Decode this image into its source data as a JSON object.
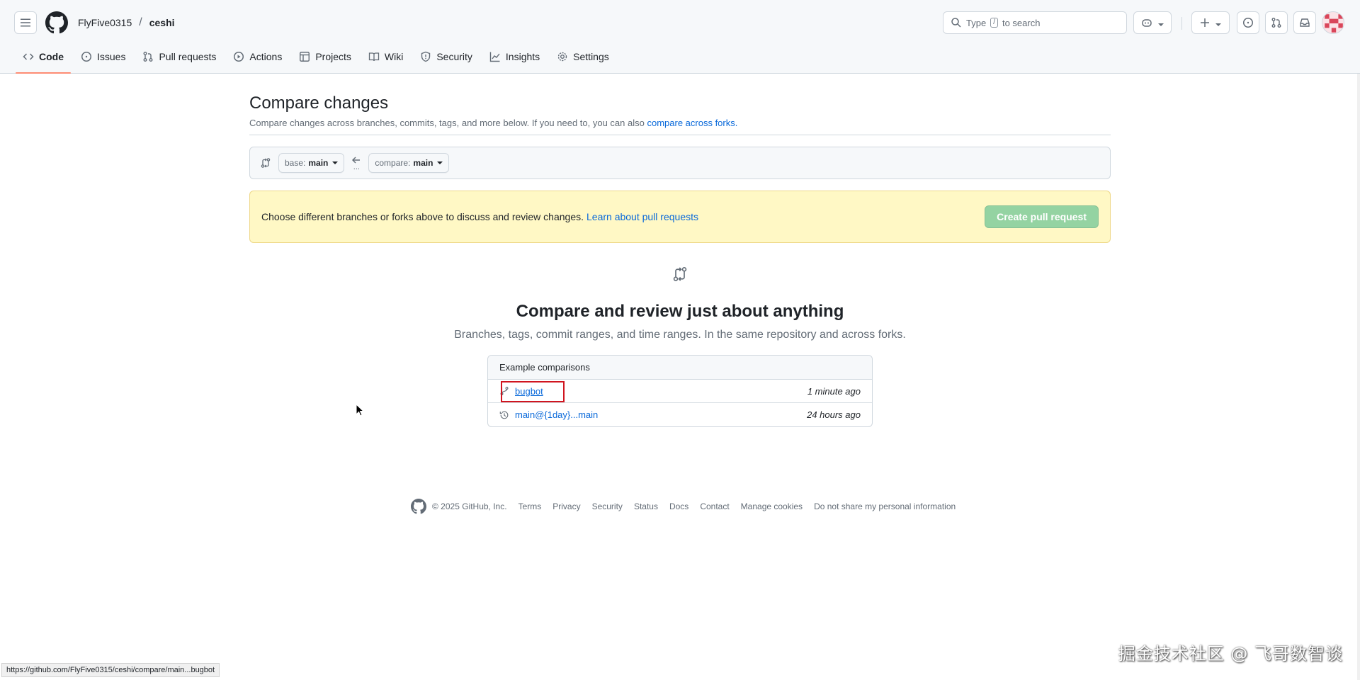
{
  "header": {
    "owner": "FlyFive0315",
    "separator": "/",
    "repo": "ceshi",
    "search_prefix": "Type",
    "search_key": "/",
    "search_suffix": "to search"
  },
  "tabs": [
    {
      "label": "Code",
      "icon": "code-icon",
      "active": true
    },
    {
      "label": "Issues",
      "icon": "issue-icon"
    },
    {
      "label": "Pull requests",
      "icon": "pull-request-icon"
    },
    {
      "label": "Actions",
      "icon": "play-icon"
    },
    {
      "label": "Projects",
      "icon": "table-icon"
    },
    {
      "label": "Wiki",
      "icon": "book-icon"
    },
    {
      "label": "Security",
      "icon": "shield-icon"
    },
    {
      "label": "Insights",
      "icon": "graph-icon"
    },
    {
      "label": "Settings",
      "icon": "gear-icon"
    }
  ],
  "compare": {
    "title": "Compare changes",
    "subtitle": "Compare changes across branches, commits, tags, and more below. If you need to, you can also",
    "subtitle_link": "compare across forks.",
    "base_prefix": "base:",
    "base_branch": "main",
    "compare_prefix": "compare:",
    "compare_branch": "main",
    "dots": "..."
  },
  "flash": {
    "text": "Choose different branches or forks above to discuss and review changes.",
    "link": "Learn about pull requests",
    "button": "Create pull request"
  },
  "blankslate": {
    "heading": "Compare and review just about anything",
    "description": "Branches, tags, commit ranges, and time ranges. In the same repository and across forks."
  },
  "examples": {
    "header": "Example comparisons",
    "rows": [
      {
        "label": "bugbot",
        "time": "1 minute ago",
        "icon": "branch-icon"
      },
      {
        "label": "main@{1day}...main",
        "time": "24 hours ago",
        "icon": "history-icon"
      }
    ]
  },
  "footer": {
    "copyright": "© 2025 GitHub, Inc.",
    "links": [
      "Terms",
      "Privacy",
      "Security",
      "Status",
      "Docs",
      "Contact",
      "Manage cookies",
      "Do not share my personal information"
    ]
  },
  "status_url": "https://github.com/FlyFive0315/ceshi/compare/main...bugbot",
  "watermark": "掘金技术社区 @ 飞哥数智谈",
  "colors": {
    "accent": "#0969da",
    "tab_underline": "#fd8c73",
    "flash_bg": "#fff8c5",
    "button_disabled": "#94d3a2",
    "highlight": "#d0151f"
  }
}
